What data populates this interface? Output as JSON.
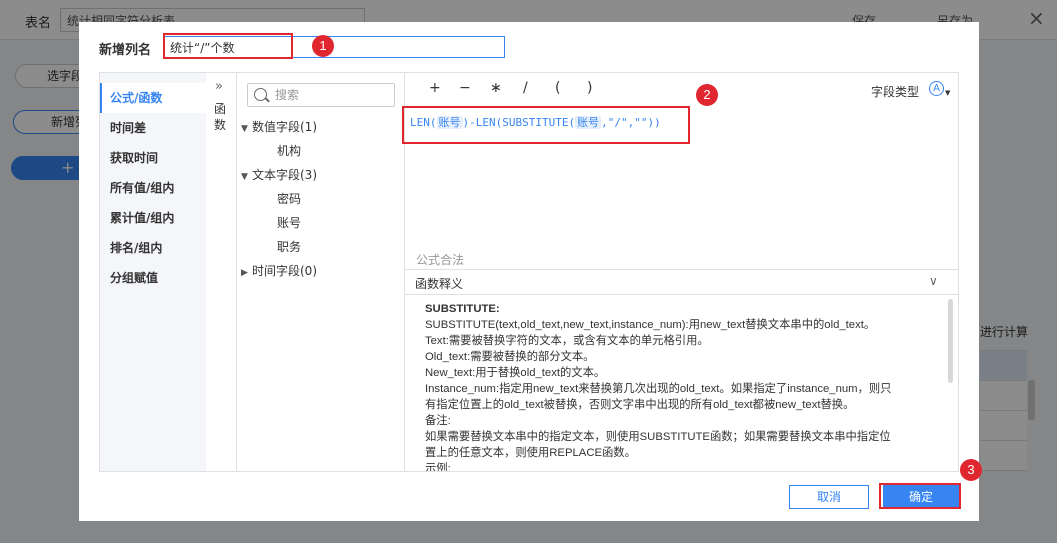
{
  "background": {
    "table_name_label": "表名",
    "table_name_value": "统计相同字符分析表",
    "save_label": "保存",
    "save_as_label": "另存为",
    "close_glyph": "×",
    "select_field_label": "选字段",
    "add_column_label": "新增列",
    "plus_label": "+",
    "right_text": "进行计算"
  },
  "dialog": {
    "title_label": "新增列名",
    "column_name_value": "统计“/”个数",
    "categories": [
      {
        "label": "公式/函数",
        "active": true
      },
      {
        "label": "时间差"
      },
      {
        "label": "获取时间"
      },
      {
        "label": "所有值/组内"
      },
      {
        "label": "累计值/组内"
      },
      {
        "label": "排名/组内"
      },
      {
        "label": "分组赋值"
      }
    ],
    "func_toggle_glyph": "»",
    "func_vertical_label": "函数",
    "search_placeholder": "搜索",
    "field_groups": [
      {
        "label": "数值字段(1)",
        "arrow": "▼",
        "items": [
          "机构"
        ]
      },
      {
        "label": "文本字段(3)",
        "arrow": "▼",
        "items": [
          "密码",
          "账号",
          "职务"
        ]
      },
      {
        "label": "时间字段(0)",
        "arrow": "▶",
        "items": []
      }
    ],
    "operators": [
      "+",
      "−",
      "∗",
      "/",
      "(",
      ")"
    ],
    "field_type_label": "字段类型",
    "field_type_icon": "A",
    "formula": {
      "p1": "LEN(",
      "tok1": "账号",
      "p2": ")-LEN(SUBSTITUTE(",
      "tok2": "账号",
      "p3": ",\"/\",\"\"))"
    },
    "formula_status": "公式合法",
    "explain_label": "函数释义",
    "explain_chevron": "∨",
    "explain_lines": [
      "SUBSTITUTE:",
      "SUBSTITUTE(text,old_text,new_text,instance_num):用new_text替换文本串中的old_text。",
      "Text:需要被替换字符的文本，或含有文本的单元格引用。",
      "Old_text:需要被替换的部分文本。",
      "New_text:用于替换old_text的文本。",
      "Instance_num:指定用new_text来替换第几次出现的old_text。如果指定了instance_num，则只",
      "有指定位置上的old_text被替换，否则文字串中出现的所有old_text都被new_text替换。",
      "备注:",
      "如果需要替换文本串中的指定文本，则使用SUBSTITUTE函数；如果需要替换文本串中指定位",
      "置上的任意文本，则使用REPLACE函数。",
      "示例:"
    ],
    "cancel_label": "取消",
    "ok_label": "确定"
  },
  "annotations": {
    "badge1": "1",
    "badge2": "2",
    "badge3": "3",
    "highlight_color": "#e0272f"
  },
  "colors": {
    "accent": "#3685f2",
    "overlay": "rgba(0,0,0,0.45)"
  }
}
